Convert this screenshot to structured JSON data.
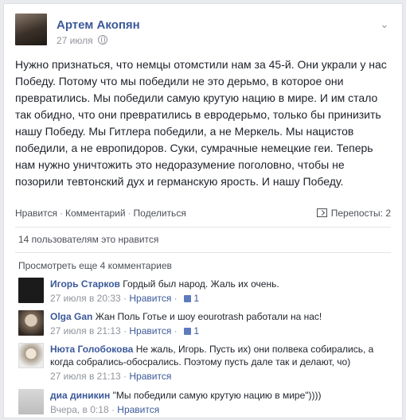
{
  "post": {
    "author": "Артем Акопян",
    "date": "27 июля",
    "text": "Нужно признаться, что немцы отомстили нам за 45-й. Они украли у нас Победу. Потому что мы победили не это дерьмо, в которое они превратились. Мы победили самую крутую нацию в мире. И им стало так обидно, что они превратились в евродерьмо, только бы принизить нашу Победу. Мы Гитлера победили, а не Меркель. Мы нацистов победили, а не европидоров. Суки, сумрачные немецкие геи. Теперь нам нужно уничтожить это недоразумение поголовно, чтобы не позорили тевтонский дух и германскую ярость. И нашу Победу."
  },
  "actions": {
    "like": "Нравится",
    "comment": "Комментарий",
    "share": "Поделиться",
    "reposts": "Перепосты: 2"
  },
  "likes_summary": "14 пользователям это нравится",
  "more_comments": "Просмотреть еще 4 комментариев",
  "comments": [
    {
      "name": "Игорь Старков",
      "text": "Гордый был народ. Жаль их очень.",
      "time": "27 июля в 20:33",
      "like_label": "Нравится",
      "likes": "1"
    },
    {
      "name": "Olga Gan",
      "text": "Жан Поль Готье и шоу eourotrash работали на нас!",
      "time": "27 июля в 21:13",
      "like_label": "Нравится",
      "likes": "1"
    },
    {
      "name": "Нюта Голобокова",
      "text": "Не жаль, Игорь. Пусть их) они полвека собирались, а когда собрались-обосрались. Поэтому пусть дале так и делают, чо)",
      "time": "27 июля в 21:13",
      "like_label": "Нравится",
      "likes": ""
    },
    {
      "name": "диа диникин",
      "text": "\"Мы победили самую крутую нацию в мире\"))))",
      "time": "Вчера, в 0:18",
      "like_label": "Нравится",
      "likes": ""
    }
  ],
  "icons": {
    "chevron": "chevron-down-icon",
    "globe": "globe-icon",
    "share": "share-icon",
    "thumb": "thumbs-up-icon"
  },
  "colors": {
    "link": "#3b5998",
    "meta": "#90949c"
  }
}
